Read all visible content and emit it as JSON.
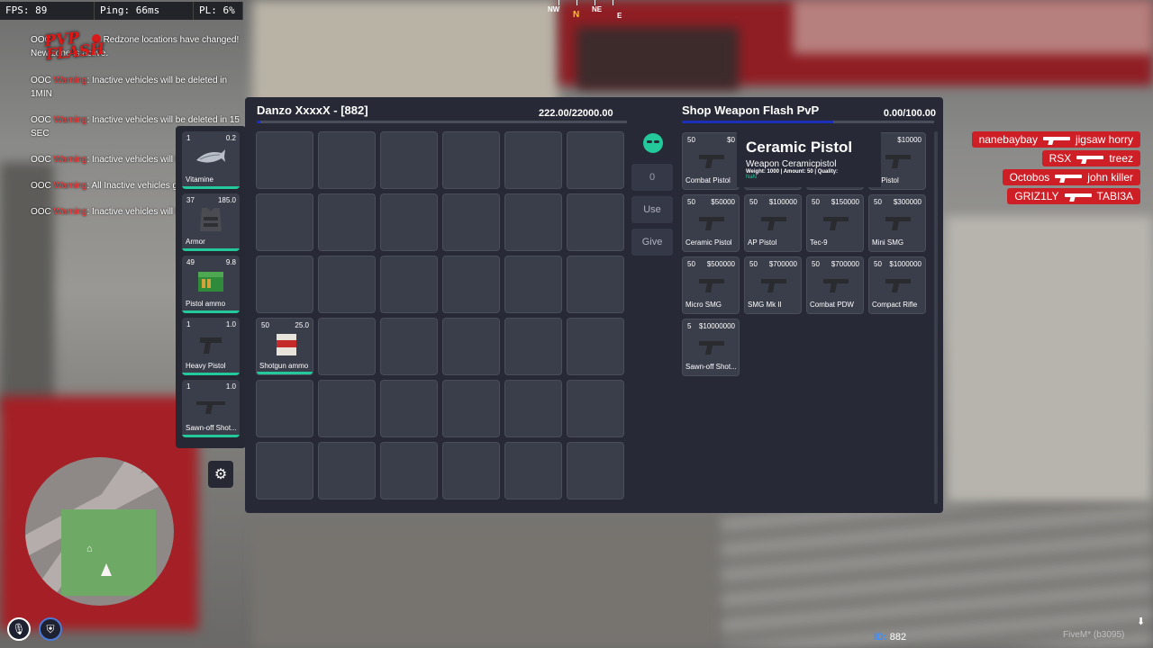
{
  "hud": {
    "fps": "FPS: 89",
    "ping": "Ping: 66ms",
    "pl": "PL: 6%"
  },
  "compass": {
    "nw": "NW",
    "n": "N",
    "ne": "NE",
    "e": "E"
  },
  "chat": [
    {
      "prefix": "OOC",
      "text": "Redzone locations have changed! New zone is active."
    },
    {
      "prefix": "OOC",
      "warning": "Warning",
      "text": ": Inactive vehicles will be deleted in 1MIN"
    },
    {
      "prefix": "OOC",
      "warning": "Warning",
      "text": ": Inactive vehicles will be deleted in 15 SEC"
    },
    {
      "prefix": "OOC",
      "warning": "Warning",
      "text": ": Inactive vehicles will be"
    },
    {
      "prefix": "OOC",
      "warning": "Warning",
      "text": ": All Inactive vehicles got"
    },
    {
      "prefix": "OOC",
      "warning": "Warning",
      "text": ": Inactive vehicles will be"
    }
  ],
  "logo": {
    "line1": "PVP",
    "line2": "FLASH"
  },
  "killfeed": [
    {
      "killer": "nanebaybay",
      "victim": "jigsaw horry"
    },
    {
      "killer": "RSX",
      "victim": "treez"
    },
    {
      "killer": "Octobos",
      "victim": "john killer"
    },
    {
      "killer": "GRIZ1LY",
      "victim": "TABI3A"
    }
  ],
  "hotbar": [
    {
      "count": "1",
      "weight": "0.2",
      "label": "Vitamine",
      "icon": "fish-icon"
    },
    {
      "count": "37",
      "weight": "185.0",
      "label": "Armor",
      "icon": "vest-icon"
    },
    {
      "count": "49",
      "weight": "9.8",
      "label": "Pistol ammo",
      "icon": "ammo-box-icon"
    },
    {
      "count": "1",
      "weight": "1.0",
      "label": "Heavy Pistol",
      "icon": "pistol-icon"
    },
    {
      "count": "1",
      "weight": "1.0",
      "label": "Sawn-off Shot...",
      "icon": "shotgun-icon"
    }
  ],
  "inventory": {
    "title": "Danzo XxxxX - [882]",
    "weight": "222.00/22000.00",
    "weight_fraction": 0.01,
    "item": {
      "count": "50",
      "weight": "25.0",
      "label": "Shotgun ammo",
      "icon": "shotgun-ammo-icon"
    }
  },
  "actions": {
    "amount": "0",
    "use": "Use",
    "give": "Give"
  },
  "shop": {
    "title": "Shop Weapon Flash PvP",
    "weight": "0.00/100.00",
    "weight_fraction": 0.6,
    "items": [
      {
        "count": "50",
        "price": "$0",
        "label": "Combat Pistol"
      },
      {
        "count": "",
        "price": "",
        "label": ""
      },
      {
        "count": "",
        "price": "",
        "label": ""
      },
      {
        "count": "",
        "price": "$10000",
        "label": "vy Pistol"
      },
      {
        "count": "50",
        "price": "$50000",
        "label": "Ceramic Pistol"
      },
      {
        "count": "50",
        "price": "$100000",
        "label": "AP Pistol"
      },
      {
        "count": "50",
        "price": "$150000",
        "label": "Tec-9"
      },
      {
        "count": "50",
        "price": "$300000",
        "label": "Mini SMG"
      },
      {
        "count": "50",
        "price": "$500000",
        "label": "Micro SMG"
      },
      {
        "count": "50",
        "price": "$700000",
        "label": "SMG Mk II"
      },
      {
        "count": "50",
        "price": "$700000",
        "label": "Combat PDW"
      },
      {
        "count": "50",
        "price": "$1000000",
        "label": "Compact Rifle"
      },
      {
        "count": "5",
        "price": "$10000000",
        "label": "Sawn-off Shot..."
      }
    ]
  },
  "tooltip": {
    "name": "Ceramic Pistol",
    "sub": "Weapon Ceramicpistol",
    "meta": "Weight: 1000 | Amount: 50 | Quality:",
    "quality": "NaN"
  },
  "footer": {
    "id_key": "ID:",
    "id_value": "882",
    "fivem": "FiveM* (b3095)"
  },
  "colors": {
    "panel": "#272a36",
    "slot": "#3a3d4a",
    "accent_green": "#23c99a",
    "progress_blue": "#1c2fb8",
    "warning_red": "#ff3b3b",
    "kill_red": "#cf1f26"
  }
}
